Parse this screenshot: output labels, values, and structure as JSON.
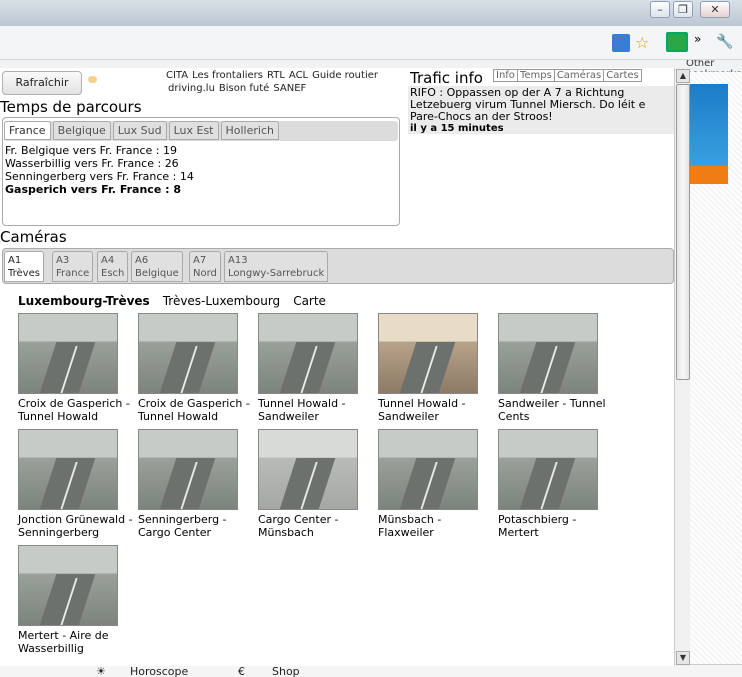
{
  "browser": {
    "window_buttons": {
      "min": "–",
      "max": "❐",
      "close": "✕"
    },
    "bookmarks_partial": "Other bookmarks"
  },
  "toolbar": {
    "refresh_label": "Rafraîchir",
    "links": [
      "CITA",
      "Les frontaliers",
      "RTL",
      "ACL",
      "Guide routier",
      "driving.lu",
      "Bison futé",
      "SANEF"
    ]
  },
  "temps": {
    "title": "Temps de parcours",
    "tabs": [
      "France",
      "Belgique",
      "Lux Sud",
      "Lux Est",
      "Hollerich"
    ],
    "rows": [
      {
        "text": "Fr. Belgique vers Fr. France : 19"
      },
      {
        "text": "Wasserbillig vers Fr. France : 26"
      },
      {
        "text": "Senningerberg vers Fr. France : 14"
      },
      {
        "text": "Gasperich vers Fr. France : 8"
      }
    ]
  },
  "trafic": {
    "title": "Trafic info",
    "tabs": [
      "Info",
      "Temps",
      "Caméras",
      "Cartes"
    ],
    "message": "RIFO : Oppassen op der A 7 a Richtung Letzebuerg virum Tunnel Miersch. Do léit e Pare-Chocs an der Stroos!",
    "time": "il y a 15 minutes"
  },
  "cameras": {
    "title": "Caméras",
    "tabs": [
      {
        "code": "A1",
        "name": "Trèves"
      },
      {
        "code": "A3",
        "name": "France"
      },
      {
        "code": "A4",
        "name": "Esch"
      },
      {
        "code": "A6",
        "name": "Belgique"
      },
      {
        "code": "A7",
        "name": "Nord"
      },
      {
        "code": "A13",
        "name": "Longwy-Sarrebruck"
      }
    ],
    "subnav": [
      "Luxembourg-Trèves",
      "Trèves-Luxembourg",
      "Carte"
    ],
    "items": [
      {
        "line1": "Croix de Gasperich -",
        "line2": "Tunnel Howald"
      },
      {
        "line1": "Croix de Gasperich -",
        "line2": "Tunnel Howald"
      },
      {
        "line1": "Tunnel Howald -",
        "line2": "Sandweiler"
      },
      {
        "line1": "Tunnel Howald -",
        "line2": "Sandweiler"
      },
      {
        "line1": "Sandweiler - Tunnel",
        "line2": "Cents"
      },
      {
        "line1": "Jonction Grünewald -",
        "line2": "Senningerberg"
      },
      {
        "line1": "Senningerberg -",
        "line2": "Cargo Center"
      },
      {
        "line1": "Cargo Center -",
        "line2": "Münsbach"
      },
      {
        "line1": "Münsbach -",
        "line2": "Flaxweiler"
      },
      {
        "line1": "Potaschbierg -",
        "line2": "Mertert"
      },
      {
        "line1": "Mertert - Aire de",
        "line2": "Wasserbillig"
      }
    ]
  },
  "bottom_strip": [
    "Horoscope",
    "Shop"
  ]
}
